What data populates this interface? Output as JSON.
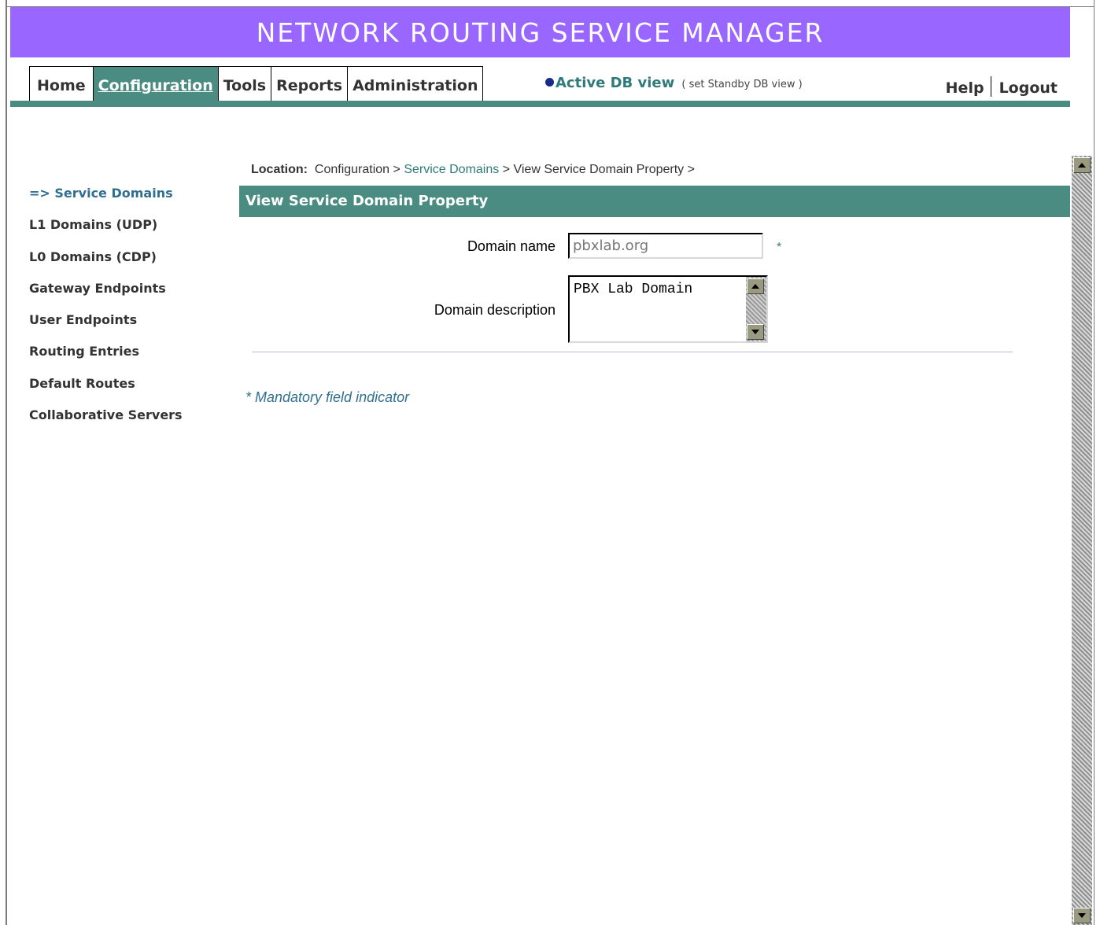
{
  "header": {
    "title": "NETWORK ROUTING SERVICE MANAGER"
  },
  "nav": {
    "tabs": [
      {
        "label": "Home"
      },
      {
        "label": "Configuration"
      },
      {
        "label": "Tools"
      },
      {
        "label": "Reports"
      },
      {
        "label": "Administration"
      }
    ],
    "active_tab": "Configuration",
    "db_active": "Active DB view",
    "db_standby": "( set Standby DB view )",
    "help": "Help",
    "logout": "Logout"
  },
  "sidebar": {
    "items": [
      {
        "label": "=> Service Domains"
      },
      {
        "label": "L1 Domains (UDP)"
      },
      {
        "label": "L0 Domains (CDP)"
      },
      {
        "label": "Gateway Endpoints"
      },
      {
        "label": "User Endpoints"
      },
      {
        "label": "Routing Entries"
      },
      {
        "label": "Default Routes"
      },
      {
        "label": "Collaborative Servers"
      }
    ]
  },
  "breadcrumb": {
    "label": "Location:",
    "part1": "Configuration >",
    "part2": "Service Domains",
    "part3": "> View Service Domain Property >"
  },
  "panel": {
    "title": "View Service Domain Property"
  },
  "form": {
    "domain_name_label": "Domain name",
    "domain_name_value": "pbxlab.org",
    "required_marker": "*",
    "domain_desc_label": "Domain description",
    "domain_desc_value": "PBX Lab Domain"
  },
  "footer_note": "* Mandatory field indicator",
  "colors": {
    "header_bg": "#9966ff",
    "accent_teal": "#4a8c82",
    "link_teal": "#2f7a7a"
  }
}
